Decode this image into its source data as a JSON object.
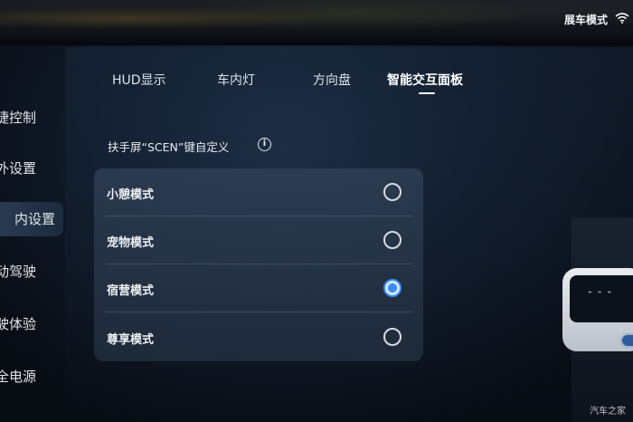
{
  "status": {
    "mode_label": "展车模式",
    "wifi_icon": "wifi-icon"
  },
  "sidebar": {
    "items": [
      {
        "label": "捷控制"
      },
      {
        "label": "外设置"
      },
      {
        "label": "内设置"
      },
      {
        "label": "动驾驶"
      },
      {
        "label": "驶体验"
      },
      {
        "label": "全电源"
      }
    ],
    "active_index": 2
  },
  "tabs": [
    {
      "label": "HUD显示"
    },
    {
      "label": "车内灯"
    },
    {
      "label": "方向盘"
    },
    {
      "label": "智能交互面板"
    }
  ],
  "active_tab": 3,
  "section": {
    "title": "扶手屏“SCEN”键自定义",
    "info_icon": "info-icon"
  },
  "options": [
    {
      "label": "小憩模式",
      "selected": false
    },
    {
      "label": "宠物模式",
      "selected": false
    },
    {
      "label": "宿营模式",
      "selected": true
    },
    {
      "label": "尊享模式",
      "selected": false
    }
  ],
  "colors": {
    "accent": "#3a8df0",
    "background": "#05080d"
  },
  "watermark": "汽车之家"
}
